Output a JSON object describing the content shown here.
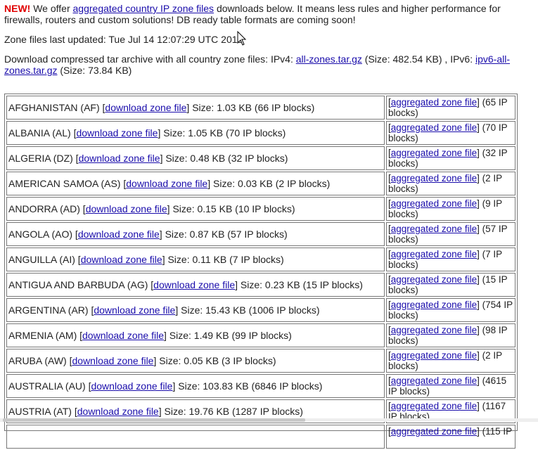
{
  "intro": {
    "new_label": "NEW!",
    "text_before": " We offer ",
    "link": "aggregated country IP zone files",
    "text_after": " downloads below. It means less rules and higher performance for firewalls, routers and custom solutions! DB ready table formats are coming soon!"
  },
  "updated": "Zone files last updated: Tue Jul 14 12:07:29 UTC 2015",
  "download": {
    "prefix": "Download compressed tar archive with all country zone files: IPv4: ",
    "ipv4_link": "all-zones.tar.gz",
    "ipv4_size": " (Size: 482.54 KB) , IPv6: ",
    "ipv6_link": "ipv6-all-zones.tar.gz",
    "ipv6_size": " (Size: 73.84 KB)"
  },
  "table": {
    "rows": [
      {
        "country": "AFGHANISTAN (AF)",
        "size": "Size: 1.03 KB (66 IP blocks)",
        "agg": "(65 IP blocks)"
      },
      {
        "country": "ALBANIA (AL)",
        "size": "Size: 1.05 KB (70 IP blocks)",
        "agg": "(70 IP blocks)"
      },
      {
        "country": "ALGERIA (DZ)",
        "size": "Size: 0.48 KB (32 IP blocks)",
        "agg": "(32 IP blocks)"
      },
      {
        "country": "AMERICAN SAMOA (AS)",
        "size": "Size: 0.03 KB (2 IP blocks)",
        "agg": "(2 IP blocks)"
      },
      {
        "country": "ANDORRA (AD)",
        "size": "Size: 0.15 KB (10 IP blocks)",
        "agg": "(9 IP blocks)"
      },
      {
        "country": "ANGOLA (AO)",
        "size": "Size: 0.87 KB (57 IP blocks)",
        "agg": "(57 IP blocks)"
      },
      {
        "country": "ANGUILLA (AI)",
        "size": "Size: 0.11 KB (7 IP blocks)",
        "agg": "(7 IP blocks)"
      },
      {
        "country": "ANTIGUA AND BARBUDA (AG)",
        "size": "Size: 0.23 KB (15 IP blocks)",
        "agg": "(15 IP blocks)"
      },
      {
        "country": "ARGENTINA (AR)",
        "size": "Size: 15.43 KB (1006 IP blocks)",
        "agg": "(754 IP blocks)"
      },
      {
        "country": "ARMENIA (AM)",
        "size": "Size: 1.49 KB (99 IP blocks)",
        "agg": "(98 IP blocks)"
      },
      {
        "country": "ARUBA (AW)",
        "size": "Size: 0.05 KB (3 IP blocks)",
        "agg": "(2 IP blocks)"
      },
      {
        "country": "AUSTRALIA (AU)",
        "size": "Size: 103.83 KB (6846 IP blocks)",
        "agg": "(4615 IP blocks)"
      },
      {
        "country": "AUSTRIA (AT)",
        "size": "Size: 19.76 KB (1287 IP blocks)",
        "agg": "(1167 IP blocks)"
      },
      {
        "country": "",
        "size": "",
        "agg": "(115 IP"
      }
    ],
    "download_link": "download zone file",
    "agg_link": "aggregated zone file"
  }
}
